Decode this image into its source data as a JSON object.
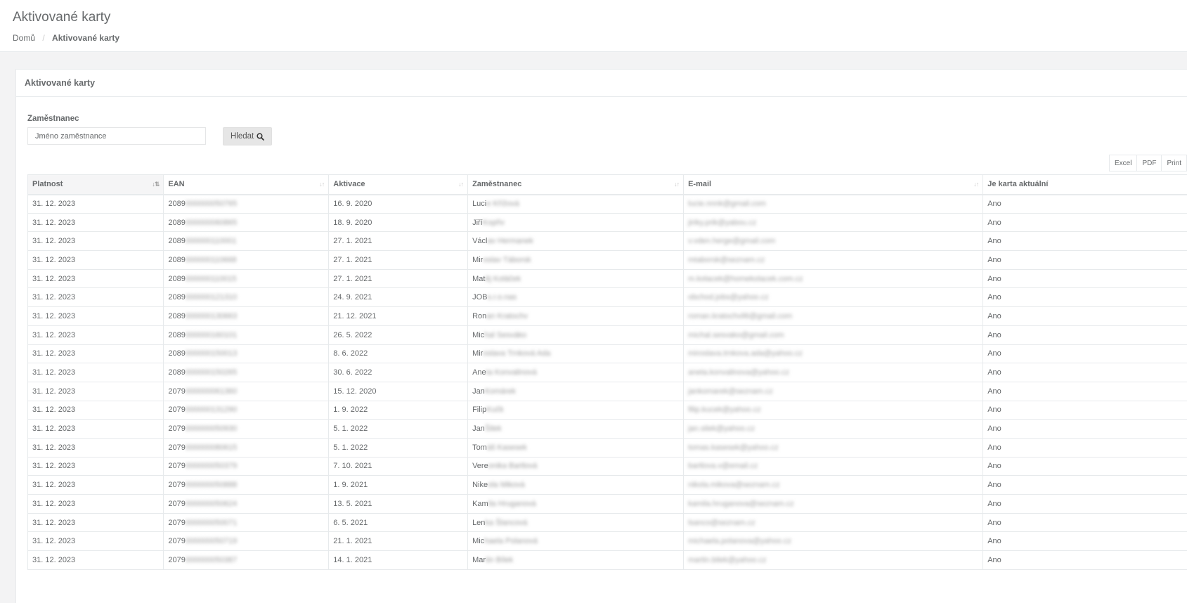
{
  "header": {
    "title": "Aktivované karty",
    "breadcrumb": {
      "home": "Domů",
      "separator": "/",
      "current": "Aktivované karty"
    }
  },
  "panel": {
    "title": "Aktivované karty",
    "filter_label": "Zaměstnanec",
    "filter_placeholder": "Jméno zaměstnance",
    "filter_value": "",
    "search_label": "Hledat",
    "export": {
      "excel": "Excel",
      "pdf": "PDF",
      "print": "Print"
    }
  },
  "table": {
    "columns": [
      "Platnost",
      "EAN",
      "Aktivace",
      "Zaměstnanec",
      "E-mail",
      "Je karta aktuální"
    ],
    "sorted_column": "Platnost",
    "rows": [
      {
        "platnost": "31. 12. 2023",
        "ean": "2089",
        "ean_blur": "000000050765",
        "aktivace": "16. 9. 2020",
        "name": "Luci",
        "name_blur": "e Křížová",
        "email_blur": "lucie.nnnk@gmail.com",
        "aktualni": "Ano"
      },
      {
        "platnost": "31. 12. 2023",
        "ean": "2089",
        "ean_blur": "000000060865",
        "aktivace": "18. 9. 2020",
        "name": "Jiří",
        "name_blur": " Kopřiv",
        "email_blur": "jiriky.prik@yabou.cz",
        "aktualni": "Ano"
      },
      {
        "platnost": "31. 12. 2023",
        "ean": "2089",
        "ean_blur": "000000110001",
        "aktivace": "27. 1. 2021",
        "name": "Václ",
        "name_blur": "av Hermanek",
        "email_blur": "v.vden.herge@gmail.com",
        "aktualni": "Ano"
      },
      {
        "platnost": "31. 12. 2023",
        "ean": "2089",
        "ean_blur": "000000110668",
        "aktivace": "27. 1. 2021",
        "name": "Mir",
        "name_blur": "oslav Táborsk",
        "email_blur": "mtaborsk@seznam.cz",
        "aktualni": "Ano"
      },
      {
        "platnost": "31. 12. 2023",
        "ean": "2089",
        "ean_blur": "000000110015",
        "aktivace": "27. 1. 2021",
        "name": "Mat",
        "name_blur": "ěj Koláček",
        "email_blur": "m.kolacek@homekolacek.com.cz",
        "aktualni": "Ano"
      },
      {
        "platnost": "31. 12. 2023",
        "ean": "2089",
        "ean_blur": "000000121310",
        "aktivace": "24. 9. 2021",
        "name": "JOB",
        "name_blur": "s.r.o.nas",
        "email_blur": "obchod.jobs@yahoo.cz",
        "aktualni": "Ano"
      },
      {
        "platnost": "31. 12. 2023",
        "ean": "2089",
        "ean_blur": "000000130663",
        "aktivace": "21. 12. 2021",
        "name": "Ron",
        "name_blur": "an Kratochv",
        "email_blur": "roman.kratochvil6@gmail.com",
        "aktualni": "Ano"
      },
      {
        "platnost": "31. 12. 2023",
        "ean": "2089",
        "ean_blur": "000000160101",
        "aktivace": "26. 5. 2022",
        "name": "Mic",
        "name_blur": "hal Sesváko",
        "email_blur": "michal.sesvako@gmail.com",
        "aktualni": "Ano"
      },
      {
        "platnost": "31. 12. 2023",
        "ean": "2089",
        "ean_blur": "000000150013",
        "aktivace": "8. 6. 2022",
        "name": "Mir",
        "name_blur": "oslava Trnková Ada",
        "email_blur": "miroslava.trnkova.ada@yahoo.cz",
        "aktualni": "Ano"
      },
      {
        "platnost": "31. 12. 2023",
        "ean": "2089",
        "ean_blur": "000000150265",
        "aktivace": "30. 6. 2022",
        "name": "Ane",
        "name_blur": "ta Konvalinová",
        "email_blur": "aneta.konvalinova@yahoo.cz",
        "aktualni": "Ano"
      },
      {
        "platnost": "31. 12. 2023",
        "ean": "2079",
        "ean_blur": "000000061360",
        "aktivace": "15. 12. 2020",
        "name": "Jan",
        "name_blur": " Komárek",
        "email_blur": "jankomarek@seznam.cz",
        "aktualni": "Ano"
      },
      {
        "platnost": "31. 12. 2023",
        "ean": "2079",
        "ean_blur": "000000131290",
        "aktivace": "1. 9. 2022",
        "name": "Filip",
        "name_blur": " Kučk",
        "email_blur": "filip.kucek@yahoo.cz",
        "aktualni": "Ano"
      },
      {
        "platnost": "31. 12. 2023",
        "ean": "2079",
        "ean_blur": "000000050930",
        "aktivace": "5. 1. 2022",
        "name": "Jan",
        "name_blur": " Šilek",
        "email_blur": "jan.silek@yahoo.cz",
        "aktualni": "Ano"
      },
      {
        "platnost": "31. 12. 2023",
        "ean": "2079",
        "ean_blur": "000000080615",
        "aktivace": "5. 1. 2022",
        "name": "Tom",
        "name_blur": "áš Kasesek",
        "email_blur": "tomas.kasesek@yahoo.cz",
        "aktualni": "Ano"
      },
      {
        "platnost": "31. 12. 2023",
        "ean": "2079",
        "ean_blur": "000000050379",
        "aktivace": "7. 10. 2021",
        "name": "Vere",
        "name_blur": "onika Bartlová",
        "email_blur": "bartlova.v@email.cz",
        "aktualni": "Ano"
      },
      {
        "platnost": "31. 12. 2023",
        "ean": "2079",
        "ean_blur": "000000050888",
        "aktivace": "1. 9. 2021",
        "name": "Nike",
        "name_blur": "ola Miková",
        "email_blur": "nikola.mikova@seznam.cz",
        "aktualni": "Ano"
      },
      {
        "platnost": "31. 12. 2023",
        "ean": "2079",
        "ean_blur": "000000050624",
        "aktivace": "13. 5. 2021",
        "name": "Kam",
        "name_blur": "ila Hruganová",
        "email_blur": "kamila.hruganova@seznam.cz",
        "aktualni": "Ano"
      },
      {
        "platnost": "31. 12. 2023",
        "ean": "2079",
        "ean_blur": "000000050071",
        "aktivace": "6. 5. 2021",
        "name": "Len",
        "name_blur": "ka Šlancová",
        "email_blur": "lsanco@seznam.cz",
        "aktualni": "Ano"
      },
      {
        "platnost": "31. 12. 2023",
        "ean": "2079",
        "ean_blur": "000000050719",
        "aktivace": "21. 1. 2021",
        "name": "Mic",
        "name_blur": "haela Polanová",
        "email_blur": "michaela.polanova@yahoo.cz",
        "aktualni": "Ano"
      },
      {
        "platnost": "31. 12. 2023",
        "ean": "2079",
        "ean_blur": "000000050387",
        "aktivace": "14. 1. 2021",
        "name": "Mar",
        "name_blur": "tin Bílek",
        "email_blur": "martin.bilek@yahoo.cz",
        "aktualni": "Ano"
      }
    ]
  }
}
